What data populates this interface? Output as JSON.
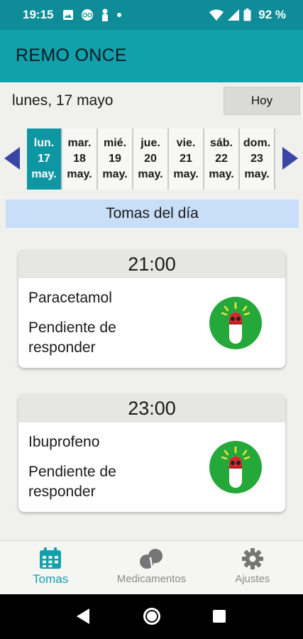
{
  "status_bar": {
    "time": "19:15",
    "battery": "92 %",
    "left_icons": [
      "image-icon",
      "cast-icon",
      "person-icon",
      "dot-icon"
    ],
    "right_icons": [
      "wifi-icon",
      "signal-icon",
      "battery-icon"
    ]
  },
  "app": {
    "title": "REMO ONCE"
  },
  "date_row": {
    "label": "lunes, 17 mayo",
    "today_button": "Hoy"
  },
  "week": {
    "prev_icon": "triangle-left-icon",
    "next_icon": "triangle-right-icon",
    "days": [
      {
        "dow": "lun.",
        "num": "17",
        "month": "may.",
        "active": true
      },
      {
        "dow": "mar.",
        "num": "18",
        "month": "may.",
        "active": false
      },
      {
        "dow": "mié.",
        "num": "19",
        "month": "may.",
        "active": false
      },
      {
        "dow": "jue.",
        "num": "20",
        "month": "may.",
        "active": false
      },
      {
        "dow": "vie.",
        "num": "21",
        "month": "may.",
        "active": false
      },
      {
        "dow": "sáb.",
        "num": "22",
        "month": "may.",
        "active": false
      },
      {
        "dow": "dom.",
        "num": "23",
        "month": "may.",
        "active": false
      }
    ]
  },
  "section": {
    "title": "Tomas del día"
  },
  "doses": [
    {
      "time": "21:00",
      "medication": "Paracetamol",
      "status": "Pendiente de responder",
      "icon": "pill-alarm-icon"
    },
    {
      "time": "23:00",
      "medication": "Ibuprofeno",
      "status": "Pendiente de responder",
      "icon": "pill-alarm-icon"
    }
  ],
  "bottom_nav": {
    "items": [
      {
        "label": "Tomas",
        "icon": "calendar-icon",
        "active": true
      },
      {
        "label": "Medicamentos",
        "icon": "pills-icon",
        "active": false
      },
      {
        "label": "Ajustes",
        "icon": "gear-icon",
        "active": false
      }
    ]
  },
  "colors": {
    "status_bar": "#0e8d98",
    "app_bar": "#11a1ac",
    "active_day": "#0e97a3",
    "arrow": "#3a46a6",
    "section_header": "#c9def8",
    "status_icon_bg": "#24a83a",
    "active_nav": "#11a1ac"
  }
}
